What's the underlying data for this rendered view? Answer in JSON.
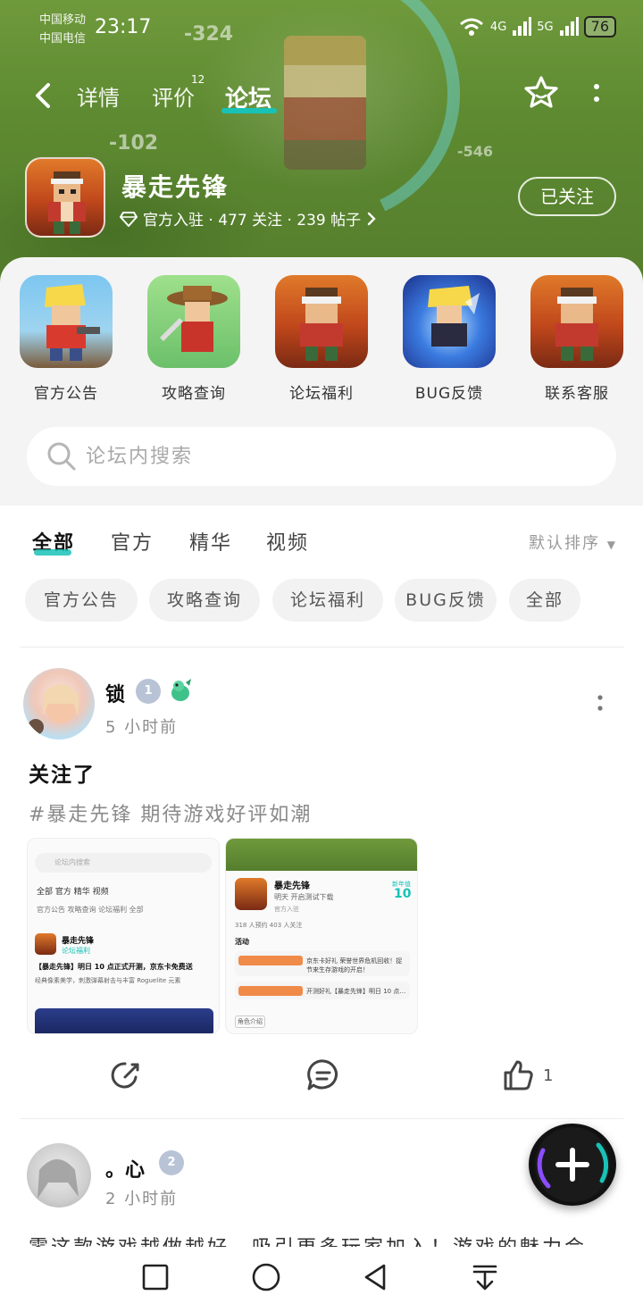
{
  "status_bar": {
    "carrier_1": "中国移动",
    "carrier_2": "中国电信",
    "time": "23:17",
    "signal_1": "4G",
    "signal_2": "5G",
    "battery": "76"
  },
  "header": {
    "tabs": [
      {
        "label": "详情"
      },
      {
        "label": "评价",
        "badge": "12"
      },
      {
        "label": "论坛",
        "active": true
      }
    ]
  },
  "game": {
    "name": "暴走先锋",
    "meta": "官方入驻 · 477 关注 · 239 帖子",
    "follow_label": "已关注"
  },
  "quick_entries": [
    {
      "label": "官方公告",
      "icon": "announcement-icon"
    },
    {
      "label": "攻略查询",
      "icon": "guide-icon"
    },
    {
      "label": "论坛福利",
      "icon": "welfare-icon"
    },
    {
      "label": "BUG反馈",
      "icon": "bug-icon"
    },
    {
      "label": "联系客服",
      "icon": "service-icon"
    }
  ],
  "search": {
    "placeholder": "论坛内搜索"
  },
  "filter_tabs": [
    {
      "label": "全部",
      "active": true
    },
    {
      "label": "官方"
    },
    {
      "label": "精华"
    },
    {
      "label": "视频"
    }
  ],
  "sort_label": "默认排序",
  "chips": [
    "官方公告",
    "攻略查询",
    "论坛福利",
    "BUG反馈",
    "全部"
  ],
  "posts": [
    {
      "user": "锁",
      "level": "1",
      "time": "5 小时前",
      "title": "关注了",
      "tag": "#暴走先锋 期待游戏好评如潮",
      "thumb1": {
        "search": "论坛内搜索",
        "tabs": "全部  官方  精华  视频",
        "chips": "官方公告  攻略查询  论坛福利  全部",
        "game": "暴走先锋",
        "sub": "论坛福利",
        "headline": "【暴走先锋】明日 10 点正式开测，京东卡免费送",
        "body": "经典像素美学，刺激弹幕射击与丰富 Roguelite 元素"
      },
      "thumb2": {
        "game": "暴走先锋",
        "line1": "明天 开启测试下载",
        "score_label": "新年值",
        "score": "10",
        "official": "官方入驻",
        "stats": "318 人预约   403 人关注",
        "activity": "活动",
        "event1": "京东卡好礼 荣誉世界危机回收！捉节来生存游戏的开启！",
        "event2": "开测好礼【暴走先锋】明日 10 点…",
        "tag": "角色介绍"
      },
      "likes": "1"
    },
    {
      "user": "。心",
      "level": "2",
      "time": "2 小时前",
      "body": "零这款游戏越做越好，吸引更多玩家加入！游戏的魅力会"
    }
  ]
}
